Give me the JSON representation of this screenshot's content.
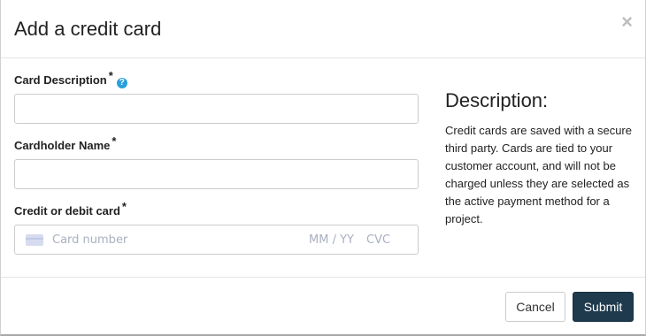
{
  "modal": {
    "title": "Add a credit card",
    "close_symbol": "×"
  },
  "form": {
    "card_description": {
      "label": "Card Description",
      "required_mark": "*",
      "help_symbol": "?",
      "value": ""
    },
    "cardholder_name": {
      "label": "Cardholder Name",
      "required_mark": "*",
      "value": ""
    },
    "card": {
      "label": "Credit or debit card",
      "required_mark": "*",
      "number_placeholder": "Card number",
      "expiry_placeholder": "MM / YY",
      "cvc_placeholder": "CVC",
      "icon": "credit-card-icon"
    }
  },
  "description": {
    "title": "Description:",
    "text": "Credit cards are saved with a secure third party. Cards are tied to your customer account, and will not be charged unless they are selected as the active payment method for a project."
  },
  "footer": {
    "cancel_label": "Cancel",
    "submit_label": "Submit"
  },
  "colors": {
    "submit_bg": "#1f3a4d",
    "help_icon": "#29a0d9"
  }
}
